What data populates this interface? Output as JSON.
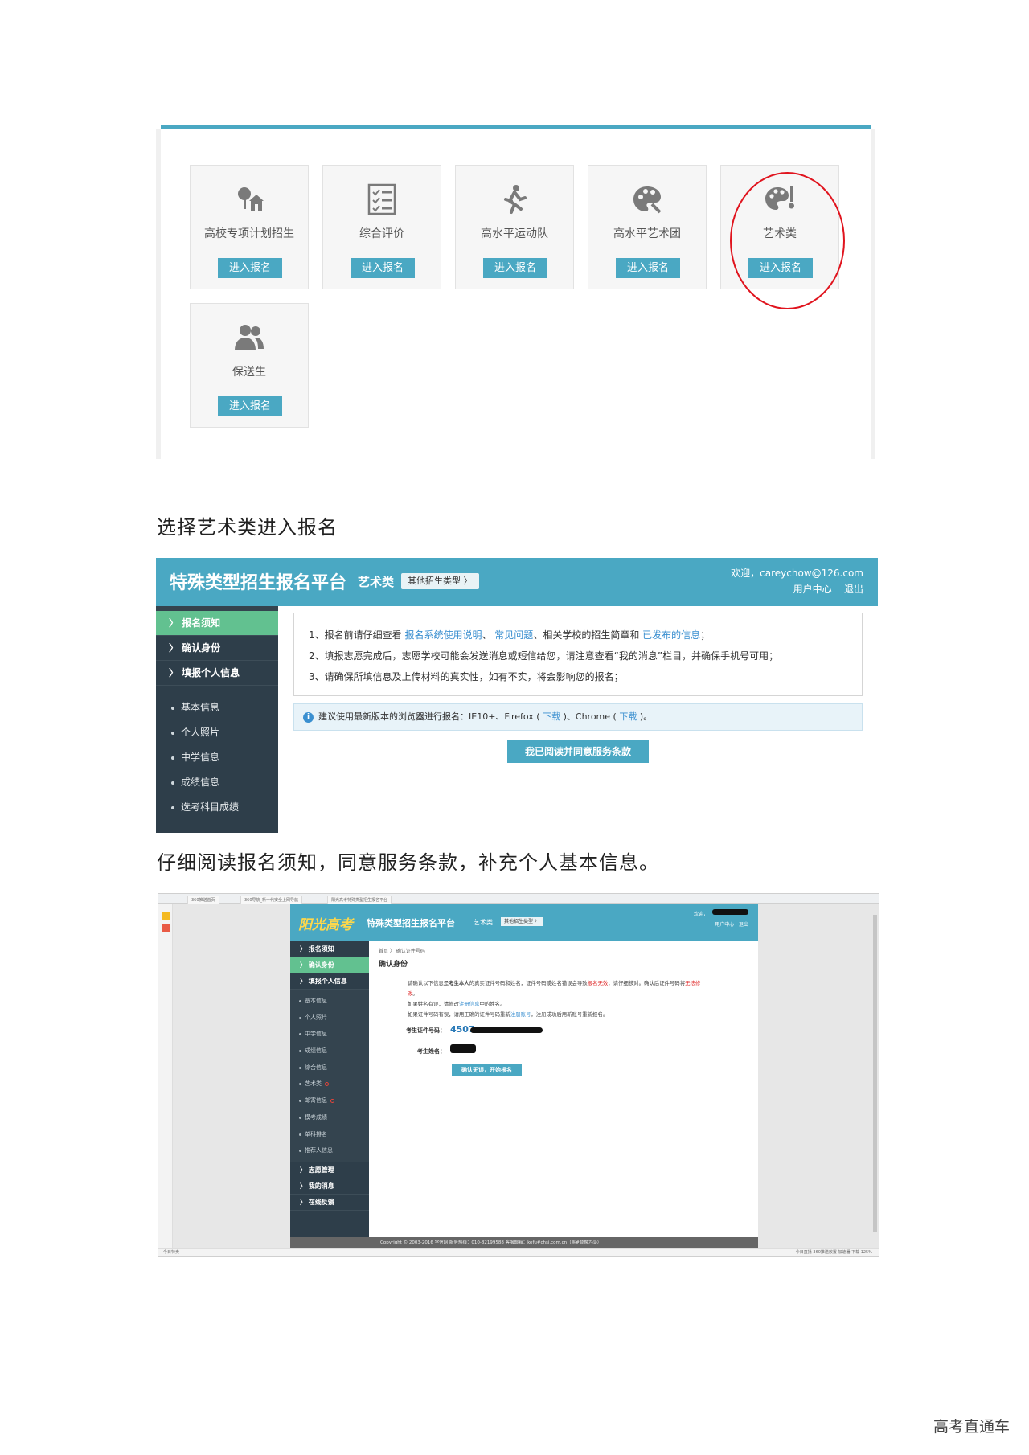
{
  "figure1": {
    "cards": [
      {
        "title": "高校专项计划招生",
        "button": "进入报名",
        "icon": "school-tree-icon"
      },
      {
        "title": "综合评价",
        "button": "进入报名",
        "icon": "checklist-icon"
      },
      {
        "title": "高水平运动队",
        "button": "进入报名",
        "icon": "runner-icon"
      },
      {
        "title": "高水平艺术团",
        "button": "进入报名",
        "icon": "palette-icon"
      },
      {
        "title": "艺术类",
        "button": "进入报名",
        "icon": "palette-brush-icon"
      },
      {
        "title": "保送生",
        "button": "进入报名",
        "icon": "people-icon"
      }
    ],
    "highlight_color": "#e0141e"
  },
  "caption1": "选择艺术类进入报名",
  "figure2": {
    "brand": "特殊类型招生报名平台",
    "category": "艺术类",
    "other_types": "其他招生类型 〉",
    "welcome": "欢迎，careychow@126.com",
    "user_center": "用户中心",
    "logout": "退出",
    "menu": [
      "〉 报名须知",
      "〉 确认身份",
      "〉 填报个人信息"
    ],
    "submenu": [
      "基本信息",
      "个人照片",
      "中学信息",
      "成绩信息",
      "选考科目成绩"
    ],
    "notice": {
      "l1_a": "1、报名前请仔细查看 ",
      "l1_link1": "报名系统使用说明",
      "l1_sep1": "、 ",
      "l1_link2": "常见问题",
      "l1_b": "、相关学校的招生简章和 ",
      "l1_link3": "已发布的信息",
      "l1_c": "；",
      "l2": "2、填报志愿完成后，志愿学校可能会发送消息或短信给您，请注意查看“我的消息”栏目，并确保手机号可用；",
      "l3": "3、请确保所填信息及上传材料的真实性，如有不实，将会影响您的报名；"
    },
    "tip": {
      "icon": "info-icon",
      "a": "建议使用最新版本的浏览器进行报名：IE10+、Firefox ( ",
      "link1": "下载",
      "b": " )、Chrome ( ",
      "link2": "下载",
      "c": " )。"
    },
    "agree_button": "我已阅读并同意服务条款",
    "accent": "#4aa8c3",
    "active_menu": "#62c190"
  },
  "caption2": "仔细阅读报名须知，同意服务条款，补充个人基本信息。",
  "figure3": {
    "tabs": [
      "360推送首页",
      "360导航_新一代安全上网导航",
      "阳光高考特殊类型招生报名平台"
    ],
    "logo": "阳光高考",
    "brand": "特殊类型招生报名平台",
    "category": "艺术类",
    "other_types": "其他招生类型 〉",
    "welcome": "欢迎，",
    "user_center": "用户中心",
    "logout": "退出",
    "menu_top": [
      "〉 报名须知",
      "〉 确认身份",
      "〉 填报个人信息"
    ],
    "submenu": [
      {
        "label": "基本信息",
        "dot": false
      },
      {
        "label": "个人照片",
        "dot": false
      },
      {
        "label": "中学信息",
        "dot": false
      },
      {
        "label": "成绩信息",
        "dot": false
      },
      {
        "label": "综合信息",
        "dot": false
      },
      {
        "label": "艺术类",
        "dot": true
      },
      {
        "label": "邮寄信息",
        "dot": true
      },
      {
        "label": "模考成绩",
        "dot": false
      },
      {
        "label": "单科排名",
        "dot": false
      },
      {
        "label": "推荐人信息",
        "dot": false
      }
    ],
    "menu_bottom": [
      "〉 志愿管理",
      "〉 我的消息",
      "〉 在线反馈"
    ],
    "breadcrumb": "首页 〉 确认证件号码",
    "title": "确认身份",
    "para": {
      "p1a": "请确认以下信息是",
      "p1b": "考生本人",
      "p1c": "的真实证件号码和姓名，证件号码或姓名错误会导致",
      "p1d": "报名无效",
      "p1e": "，请仔细核对。确认后证件号码将",
      "p1f": "无法修改",
      "p1g": "。",
      "p2a": "如果姓名有误，请修改",
      "p2b": "注册信息",
      "p2c": "中的姓名。",
      "p3a": "如果证件号码有误，请用正确的证件号码重新",
      "p3b": "注册账号",
      "p3c": "，注册成功后用新账号重新报名。"
    },
    "id_label": "考生证件号码：",
    "id_value": "4507",
    "name_label": "考生姓名：",
    "confirm_button": "确认无误，开始报名",
    "footer": "Copyright © 2003-2016 学信网     服务热线：010-82199588     客服邮箱：kefu#chsi.com.cn（将#替换为@）",
    "status_left": "今日特卖",
    "status_right": "今日直播   360推送放置   加速器   下载   125%"
  },
  "watermark": "高考直通车"
}
